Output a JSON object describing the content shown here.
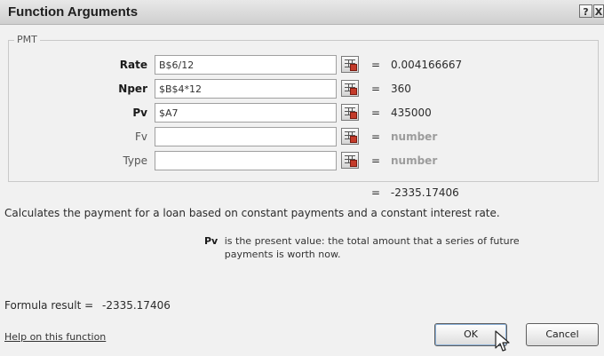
{
  "dialog": {
    "title": "Function Arguments",
    "help_button": "?",
    "close_button": "X"
  },
  "function_group": {
    "legend": "PMT",
    "arguments": [
      {
        "label": "Rate",
        "value": "B$6/12",
        "result": "0.004166667",
        "style": "bold",
        "result_style": "normal"
      },
      {
        "label": "Nper",
        "value": "$B$4*12",
        "result": "360",
        "style": "bold",
        "result_style": "normal"
      },
      {
        "label": "Pv",
        "value": "$A7",
        "result": "435000",
        "style": "bold",
        "result_style": "normal"
      },
      {
        "label": "Fv",
        "value": "",
        "result": "number",
        "style": "light",
        "result_style": "muted"
      },
      {
        "label": "Type",
        "value": "",
        "result": "number",
        "style": "light",
        "result_style": "muted"
      }
    ]
  },
  "equals_sign": "=",
  "overall_result": "-2335.17406",
  "description": "Calculates the payment for a loan based on constant payments and a constant interest rate.",
  "argument_help": {
    "name": "Pv",
    "text": "is the present value: the total amount that a series of future payments is worth now."
  },
  "formula_result": {
    "label": "Formula result =",
    "value": "-2335.17406"
  },
  "help_link": "Help on this function",
  "buttons": {
    "ok": "OK",
    "cancel": "Cancel"
  },
  "colors": {
    "dialog_bg": "#f1f1f1",
    "muted_text": "#9c9c9c",
    "ref_button_accent": "#c43b2a"
  }
}
